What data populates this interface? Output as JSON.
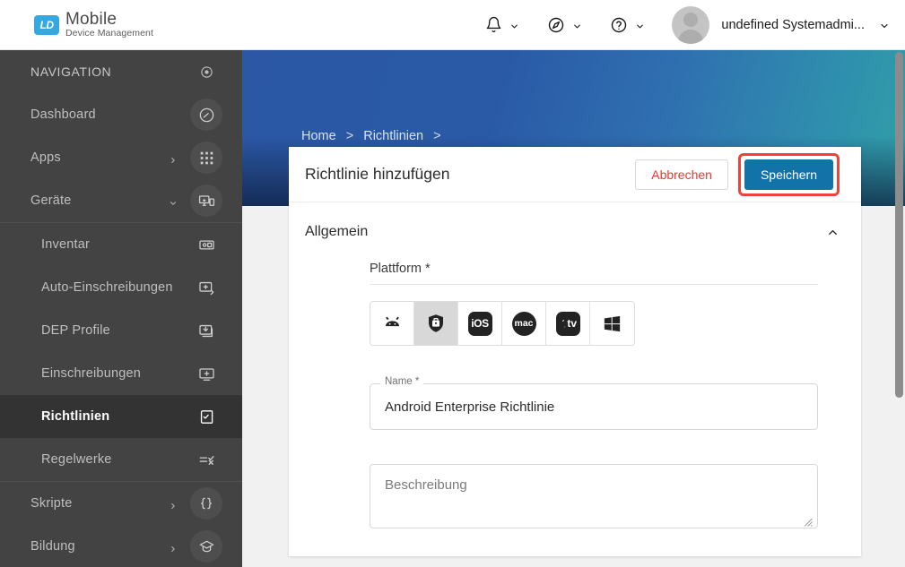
{
  "brand": {
    "badge": "LD",
    "name": "Mobile",
    "subtitle": "Device Management"
  },
  "topbar": {
    "notifications_icon": "bell-icon",
    "compass_icon": "compass-icon",
    "help_icon": "help-circle-icon",
    "user_name": "undefined Systemadmi...",
    "caret_icon": "chevron-down-icon"
  },
  "sidebar": {
    "items": [
      {
        "label": "NAVIGATION",
        "icon": "target-icon",
        "type": "header",
        "chevron": "",
        "circled": false,
        "active": false
      },
      {
        "label": "Dashboard",
        "icon": "speedometer-icon",
        "type": "item",
        "chevron": "",
        "circled": true,
        "active": false
      },
      {
        "label": "Apps",
        "icon": "apps-grid-icon",
        "type": "item",
        "chevron": "right",
        "circled": true,
        "active": false
      },
      {
        "label": "Geräte",
        "icon": "devices-icon",
        "type": "item",
        "chevron": "down",
        "circled": true,
        "active": false
      },
      {
        "label": "Inventar",
        "icon": "inventory-device-icon",
        "type": "sub",
        "chevron": "",
        "circled": false,
        "active": false
      },
      {
        "label": "Auto-Einschreibungen",
        "icon": "auto-enroll-icon",
        "type": "sub",
        "chevron": "",
        "circled": false,
        "active": false
      },
      {
        "label": "DEP Profile",
        "icon": "dep-download-icon",
        "type": "sub",
        "chevron": "",
        "circled": false,
        "active": false
      },
      {
        "label": "Einschreibungen",
        "icon": "enroll-plus-icon",
        "type": "sub",
        "chevron": "",
        "circled": false,
        "active": false
      },
      {
        "label": "Richtlinien",
        "icon": "policy-icon",
        "type": "sub",
        "chevron": "",
        "circled": false,
        "active": true
      },
      {
        "label": "Regelwerke",
        "icon": "rules-icon",
        "type": "sub",
        "chevron": "",
        "circled": false,
        "active": false
      },
      {
        "label": "Skripte",
        "icon": "braces-icon",
        "type": "item",
        "chevron": "right",
        "circled": true,
        "active": false
      },
      {
        "label": "Bildung",
        "icon": "graduation-cap-icon",
        "type": "item",
        "chevron": "right",
        "circled": true,
        "active": false
      }
    ]
  },
  "banner": {
    "breadcrumb": [
      "Home",
      "Richtlinien"
    ],
    "separator": ">",
    "title": "Richtlinie hinzufügen"
  },
  "card": {
    "title": "Richtlinie hinzufügen",
    "cancel_label": "Abbrechen",
    "save_label": "Speichern",
    "highlight_color": "#f0423a",
    "save_color": "#1273a8",
    "cancel_text_color": "#e23b33"
  },
  "section": {
    "title": "Allgemein",
    "collapse_icon": "chevron-up-icon"
  },
  "form": {
    "platform_label": "Plattform *",
    "platforms": [
      {
        "name": "android",
        "icon": "android-robot-icon",
        "selected": false
      },
      {
        "name": "android-enterprise",
        "icon": "shield-briefcase-icon",
        "selected": true
      },
      {
        "name": "ios",
        "icon": "ios-badge-icon",
        "label": "iOS",
        "selected": false
      },
      {
        "name": "macos",
        "icon": "mac-circle-icon",
        "label": "mac",
        "selected": false
      },
      {
        "name": "tvos",
        "icon": "apple-tv-icon",
        "label": "tv",
        "selected": false
      },
      {
        "name": "windows",
        "icon": "windows-logo-icon",
        "selected": false
      }
    ],
    "name_label": "Name *",
    "name_value": "Android Enterprise Richtlinie",
    "name_placeholder": "Name",
    "description_placeholder": "Beschreibung",
    "description_value": ""
  },
  "scrollbar": {
    "visible": true
  }
}
